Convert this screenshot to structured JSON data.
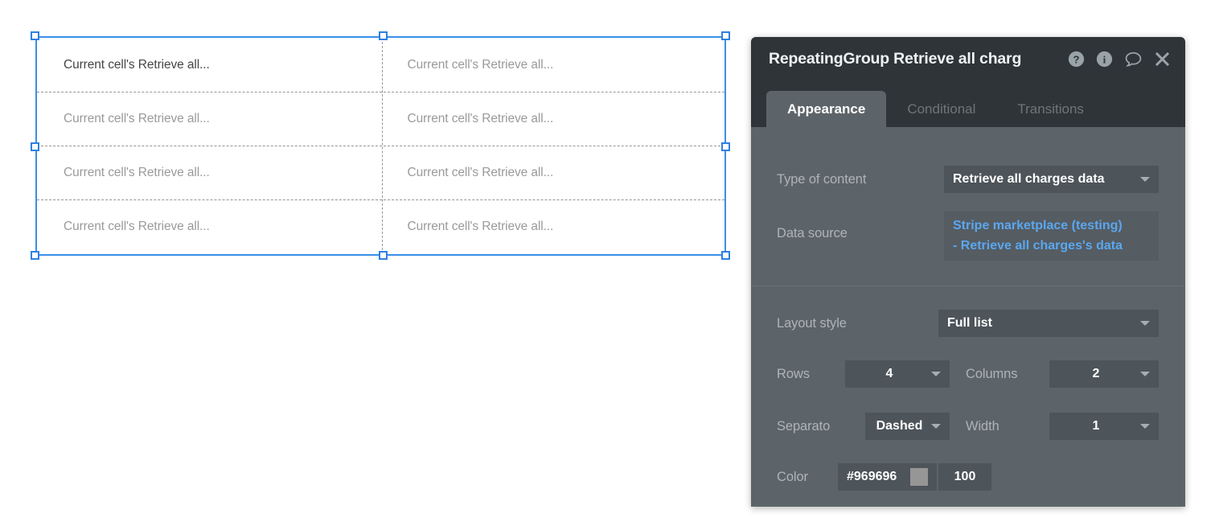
{
  "canvas": {
    "repeating_group": {
      "rows": 4,
      "columns": 2,
      "cells": [
        [
          "Current cell's Retrieve all...",
          "Current cell's Retrieve all..."
        ],
        [
          "Current cell's Retrieve all...",
          "Current cell's Retrieve all..."
        ],
        [
          "Current cell's Retrieve all...",
          "Current cell's Retrieve all..."
        ],
        [
          "Current cell's Retrieve all...",
          "Current cell's Retrieve all..."
        ]
      ],
      "selection_color": "#3b8fe8",
      "separator_color": "#969696",
      "separator_style": "dashed"
    }
  },
  "panel": {
    "title": "RepeatingGroup Retrieve all charg",
    "header_icons": [
      {
        "name": "help-icon",
        "glyph": "?"
      },
      {
        "name": "info-icon",
        "glyph": "i"
      },
      {
        "name": "comment-icon",
        "glyph": "speech-bubble"
      },
      {
        "name": "close-icon",
        "glyph": "x"
      }
    ],
    "tabs": [
      {
        "label": "Appearance",
        "active": true
      },
      {
        "label": "Conditional",
        "active": false
      },
      {
        "label": "Transitions",
        "active": false
      }
    ],
    "fields": {
      "type_of_content": {
        "label": "Type of content",
        "value": "Retrieve all charges data"
      },
      "data_source": {
        "label": "Data source",
        "line1": "Stripe marketplace (testing)",
        "line2": "- Retrieve all charges's data",
        "color": "#5aa7ef"
      },
      "layout_style": {
        "label": "Layout style",
        "value": "Full list"
      },
      "rows": {
        "label": "Rows",
        "value": "4"
      },
      "columns": {
        "label": "Columns",
        "value": "2"
      },
      "separator": {
        "label": "Separato",
        "value": "Dashed"
      },
      "width": {
        "label": "Width",
        "value": "1"
      },
      "color": {
        "label": "Color",
        "value": "#969696",
        "swatch": "#969696",
        "opacity": "100"
      }
    }
  }
}
